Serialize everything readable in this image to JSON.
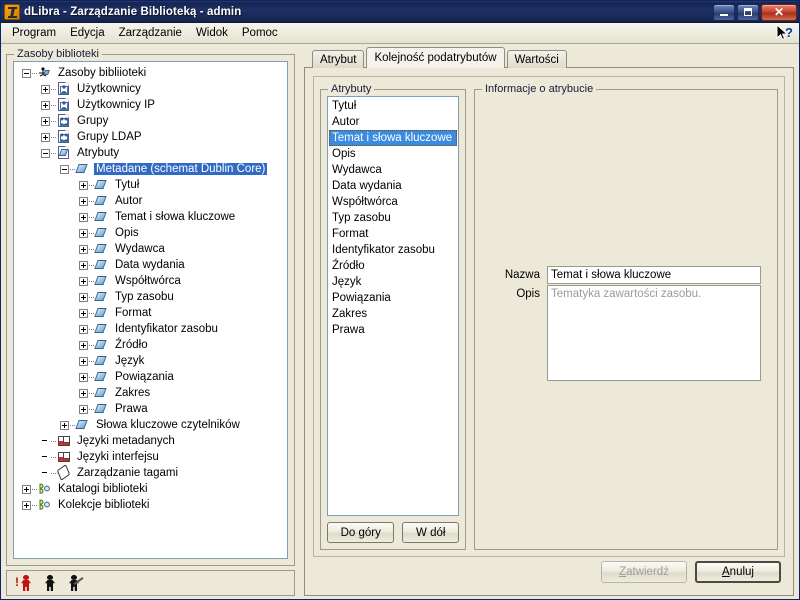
{
  "window": {
    "title": "dLibra - Zarządzanie Biblioteką - admin",
    "app_icon": "dlibra-logo-icon",
    "minimize_label": "Minimalizuj",
    "restore_label": "Przywróć",
    "close_label": "Zamknij",
    "accent_title_color": "#16244d",
    "selection_color": "#316ac5",
    "face_color": "#ece9d8"
  },
  "menubar": {
    "items": [
      {
        "label": "Program"
      },
      {
        "label": "Edycja"
      },
      {
        "label": "Zarządzanie"
      },
      {
        "label": "Widok"
      },
      {
        "label": "Pomoc"
      }
    ],
    "help_icon": "context-help-cursor-icon"
  },
  "left_pane": {
    "group_title": "Zasoby biblioteki",
    "tree": [
      {
        "depth": 0,
        "handle": "minus",
        "icon": "library-root-icon",
        "label": "Zasoby bibliioteki",
        "selected": false
      },
      {
        "depth": 1,
        "handle": "plus",
        "icon": "users-icon",
        "label": "Użytkownicy",
        "selected": false
      },
      {
        "depth": 1,
        "handle": "plus",
        "icon": "users-icon",
        "label": "Użytkownicy IP",
        "selected": false
      },
      {
        "depth": 1,
        "handle": "plus",
        "icon": "groups-icon",
        "label": "Grupy",
        "selected": false
      },
      {
        "depth": 1,
        "handle": "plus",
        "icon": "groups-icon",
        "label": "Grupy LDAP",
        "selected": false
      },
      {
        "depth": 1,
        "handle": "minus",
        "icon": "attributes-icon",
        "label": "Atrybuty",
        "selected": false
      },
      {
        "depth": 2,
        "handle": "minus",
        "icon": "attribute-icon",
        "label": "Metadane (schemat Dublin Core)",
        "selected": true
      },
      {
        "depth": 3,
        "handle": "plus",
        "icon": "attribute-icon",
        "label": "Tytuł",
        "selected": false
      },
      {
        "depth": 3,
        "handle": "plus",
        "icon": "attribute-icon",
        "label": "Autor",
        "selected": false
      },
      {
        "depth": 3,
        "handle": "plus",
        "icon": "attribute-icon",
        "label": "Temat i słowa kluczowe",
        "selected": false
      },
      {
        "depth": 3,
        "handle": "plus",
        "icon": "attribute-icon",
        "label": "Opis",
        "selected": false
      },
      {
        "depth": 3,
        "handle": "plus",
        "icon": "attribute-icon",
        "label": "Wydawca",
        "selected": false
      },
      {
        "depth": 3,
        "handle": "plus",
        "icon": "attribute-icon",
        "label": "Data wydania",
        "selected": false
      },
      {
        "depth": 3,
        "handle": "plus",
        "icon": "attribute-icon",
        "label": "Współtwórca",
        "selected": false
      },
      {
        "depth": 3,
        "handle": "plus",
        "icon": "attribute-icon",
        "label": "Typ zasobu",
        "selected": false
      },
      {
        "depth": 3,
        "handle": "plus",
        "icon": "attribute-icon",
        "label": "Format",
        "selected": false
      },
      {
        "depth": 3,
        "handle": "plus",
        "icon": "attribute-icon",
        "label": "Identyfikator zasobu",
        "selected": false
      },
      {
        "depth": 3,
        "handle": "plus",
        "icon": "attribute-icon",
        "label": "Źródło",
        "selected": false
      },
      {
        "depth": 3,
        "handle": "plus",
        "icon": "attribute-icon",
        "label": "Język",
        "selected": false
      },
      {
        "depth": 3,
        "handle": "plus",
        "icon": "attribute-icon",
        "label": "Powiązania",
        "selected": false
      },
      {
        "depth": 3,
        "handle": "plus",
        "icon": "attribute-icon",
        "label": "Zakres",
        "selected": false
      },
      {
        "depth": 3,
        "handle": "plus",
        "icon": "attribute-icon",
        "label": "Prawa",
        "selected": false
      },
      {
        "depth": 2,
        "handle": "plus",
        "icon": "attribute-icon",
        "label": "Słowa kluczowe czytelników",
        "selected": false
      },
      {
        "depth": 1,
        "handle": "none",
        "icon": "flag-icon",
        "label": "Języki metadanych",
        "selected": false
      },
      {
        "depth": 1,
        "handle": "none",
        "icon": "flag-icon",
        "label": "Języki interfejsu",
        "selected": false
      },
      {
        "depth": 1,
        "handle": "none",
        "icon": "tag-icon",
        "label": "Zarządzanie tagami",
        "selected": false
      },
      {
        "depth": 0,
        "handle": "plus",
        "icon": "catalogs-icon",
        "label": "Katalogi biblioteki",
        "selected": false
      },
      {
        "depth": 0,
        "handle": "plus",
        "icon": "collections-icon",
        "label": "Kolekcje biblioteki",
        "selected": false
      }
    ],
    "status_icons": [
      {
        "name": "user-alert-icon"
      },
      {
        "name": "user-icon"
      },
      {
        "name": "user-settings-icon"
      }
    ]
  },
  "right_pane": {
    "tabs": [
      {
        "label": "Atrybut",
        "active": false
      },
      {
        "label": "Kolejność podatrybutów",
        "active": true
      },
      {
        "label": "Wartości",
        "active": false
      }
    ],
    "attributes_group": {
      "title": "Atrybuty",
      "items": [
        {
          "label": "Tytuł",
          "selected": false
        },
        {
          "label": "Autor",
          "selected": false
        },
        {
          "label": "Temat i słowa kluczowe",
          "selected": true
        },
        {
          "label": "Opis",
          "selected": false
        },
        {
          "label": "Wydawca",
          "selected": false
        },
        {
          "label": "Data wydania",
          "selected": false
        },
        {
          "label": "Współtwórca",
          "selected": false
        },
        {
          "label": "Typ zasobu",
          "selected": false
        },
        {
          "label": "Format",
          "selected": false
        },
        {
          "label": "Identyfikator zasobu",
          "selected": false
        },
        {
          "label": "Źródło",
          "selected": false
        },
        {
          "label": "Język",
          "selected": false
        },
        {
          "label": "Powiązania",
          "selected": false
        },
        {
          "label": "Zakres",
          "selected": false
        },
        {
          "label": "Prawa",
          "selected": false
        }
      ],
      "move_up_label": "Do góry",
      "move_down_label": "W dół"
    },
    "info_group": {
      "title": "Informacje o atrybucie",
      "name_label": "Nazwa",
      "name_value": "Temat i słowa kluczowe",
      "description_label": "Opis",
      "description_value": "Tematyka zawartości zasobu."
    }
  },
  "footer": {
    "confirm_label": "Zatwierdź",
    "confirm_mnemonic": "Z",
    "confirm_enabled": false,
    "cancel_label": "Anuluj",
    "cancel_mnemonic": "A",
    "cancel_enabled": true
  }
}
